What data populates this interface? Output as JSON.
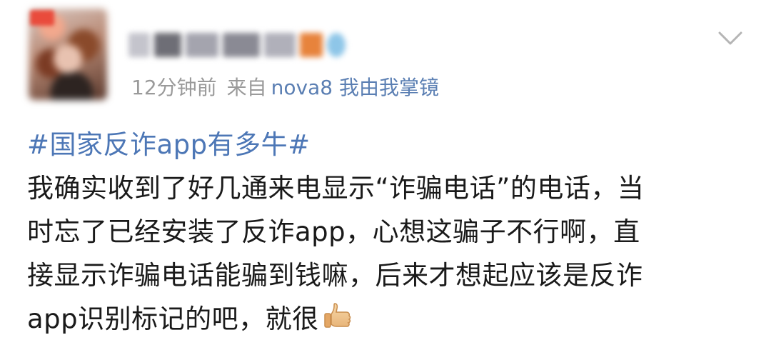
{
  "post": {
    "meta": {
      "time": "12分钟前",
      "source_prefix": "来自",
      "source": "nova8 我由我掌镜"
    },
    "hashtag": "#国家反诈app有多牛#",
    "lines": [
      "我确实收到了好几通来电显示“诈骗电话”的电话，当",
      "时忘了已经安装了反诈app，心想这骗子不行啊，直",
      "接显示诈骗电话能骗到钱嘛，后来才想起应该是反诈",
      "app识别标记的吧，就很"
    ],
    "emoji": "thumbs-up-icon"
  },
  "icons": {
    "more": "chevron-down-icon"
  },
  "colors": {
    "link": "#4d77b6",
    "source": "#5b7fb3",
    "meta": "#9a9a9a",
    "text": "#1a1a1a"
  }
}
